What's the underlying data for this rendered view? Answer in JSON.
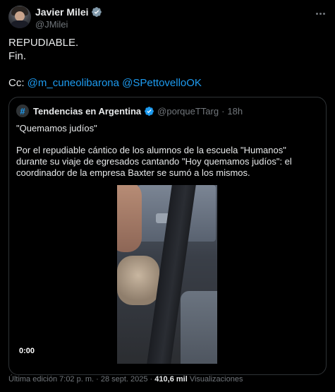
{
  "tweet": {
    "author_name": "Javier Milei",
    "author_handle": "@JMilei",
    "lines": [
      "REPUDIABLE.",
      "Fin."
    ],
    "cc_label": "Cc:",
    "mentions": [
      "@m_cuneolibarona",
      "@SPettovelloOK"
    ]
  },
  "quoted": {
    "avatar_glyph": "#",
    "name": "Tendencias en Argentina",
    "handle": "@porqueTTarg",
    "separator": "·",
    "time": "18h",
    "title": "\"Quemamos judíos\"",
    "body": "Por el repudiable cántico de los alumnos de la escuela \"Humanos\" durante su viaje de egresados cantando \"Hoy quemamos judíos\": el coordinador de la empresa Baxter se sumó a los mismos.",
    "video_time": "0:00"
  },
  "footer": {
    "edited": "Última edición 7:02 p. m. · 28 sept. 2025 ·",
    "views_count": "410,6 mil",
    "views_label": "Visualizaciones"
  },
  "colors": {
    "background": "#000000",
    "text": "#e7e9ea",
    "muted": "#71767b",
    "link": "#1d9bf0",
    "border": "#2f3336"
  },
  "icons": [
    "verified-badge-icon",
    "more-options-icon",
    "trending-hashtag-icon",
    "verified-badge-icon"
  ]
}
